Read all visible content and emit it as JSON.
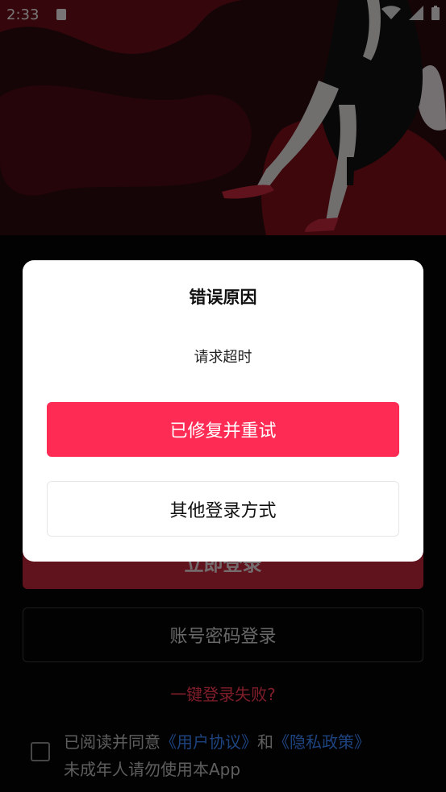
{
  "status_bar": {
    "time": "2:33",
    "icons": [
      "notification-icon",
      "wifi-icon",
      "signal-icon",
      "battery-icon"
    ]
  },
  "background_screen": {
    "login_button_label": "立即登录",
    "password_login_label": "账号密码登录",
    "fail_link": "一键登录失败?",
    "agreement": {
      "prefix": "已阅读并同意",
      "user_agreement": "《用户协议》",
      "and": "和",
      "privacy_policy": "《隐私政策》",
      "minor_notice": "未成年人请勿使用本App",
      "checked": false
    }
  },
  "dialog": {
    "title": "错误原因",
    "message": "请求超时",
    "primary_button": "已修复并重试",
    "secondary_button": "其他登录方式"
  },
  "colors": {
    "primary": "#fe2c55",
    "link": "#3a86ff",
    "fail_link": "#ff3b54"
  }
}
